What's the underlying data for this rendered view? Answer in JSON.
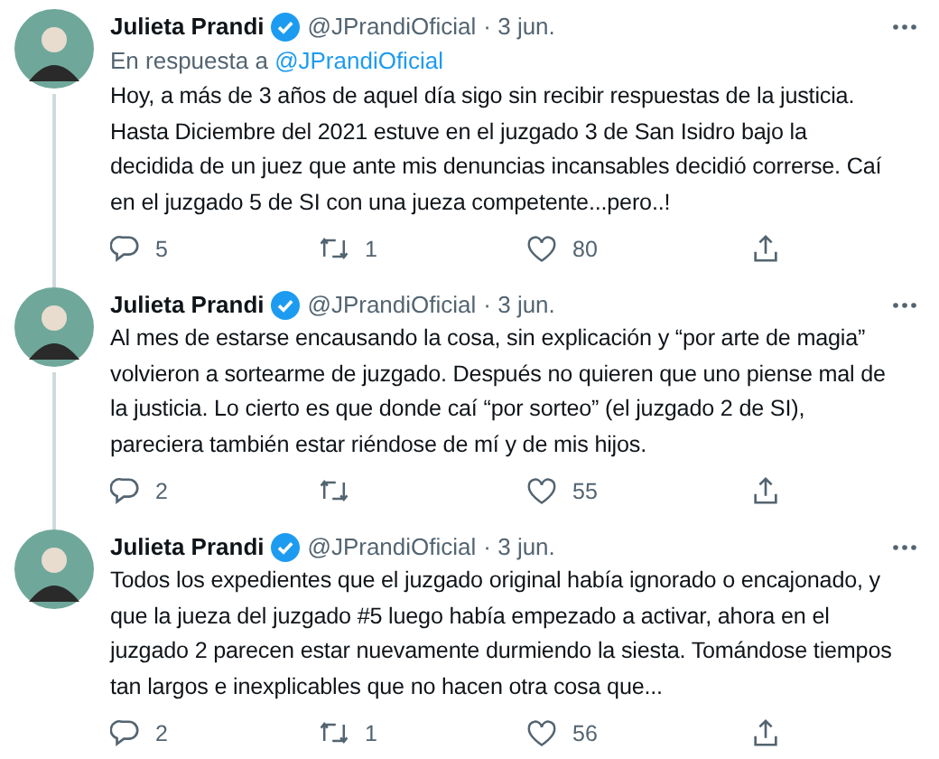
{
  "tweets": [
    {
      "name": "Julieta Prandi",
      "verified": true,
      "handle": "@JPrandiOficial",
      "date": "· 3 jun.",
      "reply_to": {
        "prefix": "En respuesta a",
        "mention": "@JPrandiOficial"
      },
      "text": "Hoy, a más de 3 años de aquel día sigo sin recibir respuestas de la justicia. Hasta Diciembre del 2021 estuve en el juzgado 3 de San Isidro bajo la decidida de un juez que ante mis denuncias incansables decidió correrse. Caí en el juzgado 5 de SI con una jueza competente...pero..!",
      "connected_below": true,
      "replies": "5",
      "retweets": "1",
      "likes": "80"
    },
    {
      "name": "Julieta Prandi",
      "verified": true,
      "handle": "@JPrandiOficial",
      "date": "· 3 jun.",
      "text": "Al mes de estarse encausando la cosa, sin explicación y “por arte de magia” volvieron a sortearme de juzgado. Después no quieren que uno piense mal de la justicia. Lo cierto es que donde caí “por sorteo” (el juzgado 2 de SI), pareciera también estar riéndose de mí y de mis hijos.",
      "connected_below": true,
      "replies": "2",
      "likes": "55"
    },
    {
      "name": "Julieta Prandi",
      "verified": true,
      "handle": "@JPrandiOficial",
      "date": "· 3 jun.",
      "text": "Todos los expedientes que el juzgado original había ignorado o encajonado, y que la jueza del juzgado #5 luego había empezado a activar, ahora en el juzgado 2 parecen estar nuevamente durmiendo la siesta. Tomándose tiempos tan largos e inexplicables que no hacen otra cosa que...",
      "connected_below": false,
      "replies": "2",
      "retweets": "1",
      "likes": "56"
    }
  ]
}
